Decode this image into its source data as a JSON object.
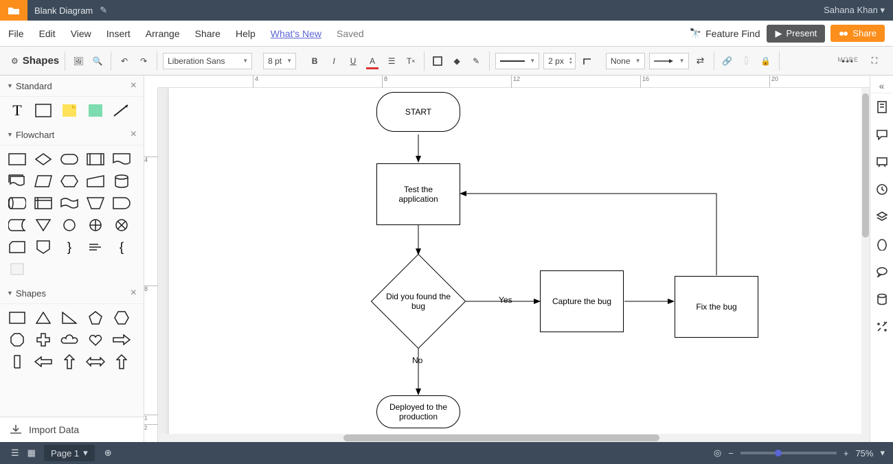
{
  "top": {
    "title": "Blank Diagram",
    "user": "Sahana Khan"
  },
  "menu": {
    "items": [
      "File",
      "Edit",
      "View",
      "Insert",
      "Arrange",
      "Share",
      "Help"
    ],
    "whats_new": "What's New",
    "saved": "Saved",
    "feature_find": "Feature Find",
    "present": "Present",
    "share": "Share"
  },
  "toolbar": {
    "shapes_label": "Shapes",
    "font": "Liberation Sans",
    "font_size": "8 pt",
    "stroke_px": "2 px",
    "line_end": "None",
    "more_label": "MORE"
  },
  "panels": {
    "standard": "Standard",
    "flowchart": "Flowchart",
    "shapes": "Shapes",
    "import": "Import Data"
  },
  "chart_data": {
    "type": "flowchart",
    "nodes": [
      {
        "id": "start",
        "shape": "terminator",
        "label": "START"
      },
      {
        "id": "test",
        "shape": "process",
        "label": "Test the\napplication"
      },
      {
        "id": "decision",
        "shape": "decision",
        "label": "Did you found the bug"
      },
      {
        "id": "capture",
        "shape": "process",
        "label": "Capture the bug"
      },
      {
        "id": "fix",
        "shape": "process",
        "label": "Fix the bug"
      },
      {
        "id": "deploy",
        "shape": "terminator",
        "label": "Deployed to the\nproduction"
      }
    ],
    "edges": [
      {
        "from": "start",
        "to": "test",
        "label": ""
      },
      {
        "from": "test",
        "to": "decision",
        "label": ""
      },
      {
        "from": "decision",
        "to": "capture",
        "label": "Yes"
      },
      {
        "from": "capture",
        "to": "fix",
        "label": ""
      },
      {
        "from": "fix",
        "to": "test",
        "label": ""
      },
      {
        "from": "decision",
        "to": "deploy",
        "label": "No"
      }
    ],
    "edge_labels": {
      "yes": "Yes",
      "no": "No"
    }
  },
  "ruler": {
    "h_ticks": [
      "4",
      "8",
      "12",
      "16",
      "20"
    ],
    "v_ticks": [
      "4",
      "8",
      "1",
      "2"
    ]
  },
  "status": {
    "page": "Page 1",
    "zoom": "75%"
  }
}
